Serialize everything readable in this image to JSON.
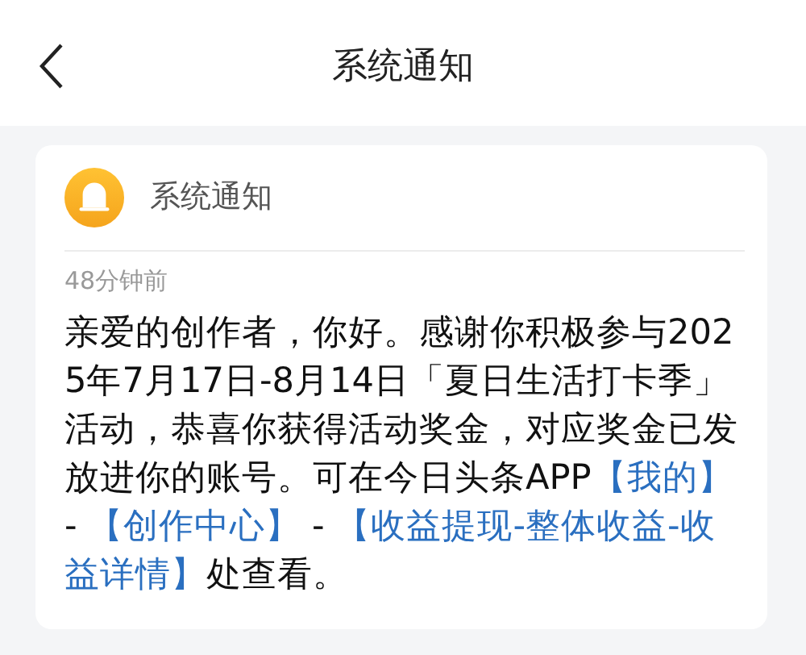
{
  "header": {
    "title": "系统通知"
  },
  "notification": {
    "sender": "系统通知",
    "time": "48分钟前",
    "message": [
      {
        "kind": "text",
        "text": "亲爱的创作者，你好。感谢你积极参与2025年7月17日-8月14日「夏日生活打卡季」活动，恭喜你获得活动奖金，对应奖金已发放进你的账号。可在今日头条APP"
      },
      {
        "kind": "highlight",
        "text": "【我的】"
      },
      {
        "kind": "text",
        "text": " - "
      },
      {
        "kind": "highlight",
        "text": "【创作中心】"
      },
      {
        "kind": "text",
        "text": " - "
      },
      {
        "kind": "highlight",
        "text": "【收益提现-整体收益-收益详情】"
      },
      {
        "kind": "text",
        "text": "处查看。"
      }
    ]
  }
}
